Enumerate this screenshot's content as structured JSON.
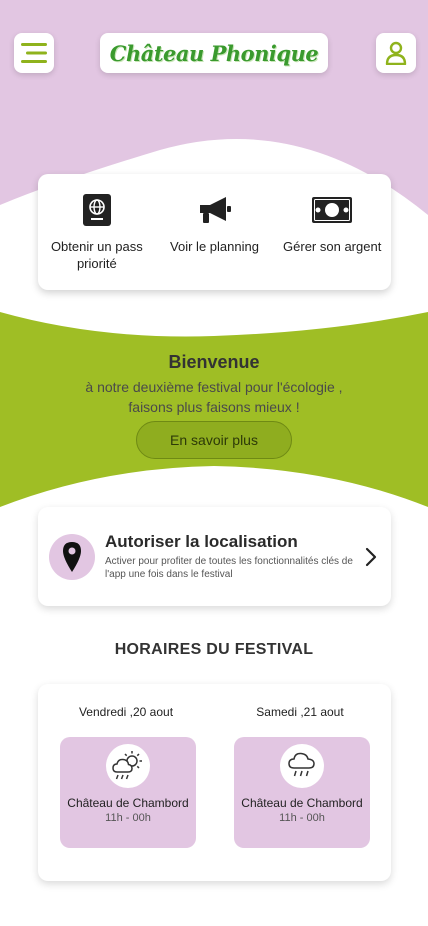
{
  "colors": {
    "accent_green": "#9fbe25",
    "lilac": "#e2c6e2",
    "button_green": "#8fad1f"
  },
  "header": {
    "menu_icon": "hamburger-icon",
    "logo_text": "Château Phonique",
    "user_icon": "user-icon"
  },
  "actions": [
    {
      "label": "Obtenir un pass priorité",
      "icon": "passport-icon"
    },
    {
      "label": "Voir le planning",
      "icon": "megaphone-icon"
    },
    {
      "label": "Gérer son argent",
      "icon": "banknote-icon"
    }
  ],
  "welcome": {
    "title": "Bienvenue",
    "text": "à notre deuxième festival pour l'écologie , faisons plus faisons mieux !",
    "button_label": "En savoir plus"
  },
  "location": {
    "title": "Autoriser la localisation",
    "subtitle": "Activer pour profiter de toutes les fonctionnalités clés de l'app une fois dans le festival",
    "icon": "map-pin-icon"
  },
  "schedule": {
    "title": "HORAIRES DU FESTIVAL",
    "days": [
      {
        "date": "Vendredi ,20 aout",
        "weather_icon": "sun-rain-icon",
        "venue": "Château de Chambord",
        "hours": "11h - 00h"
      },
      {
        "date": "Samedi ,21 aout",
        "weather_icon": "rain-icon",
        "venue": "Château de Chambord",
        "hours": "11h - 00h"
      }
    ]
  }
}
